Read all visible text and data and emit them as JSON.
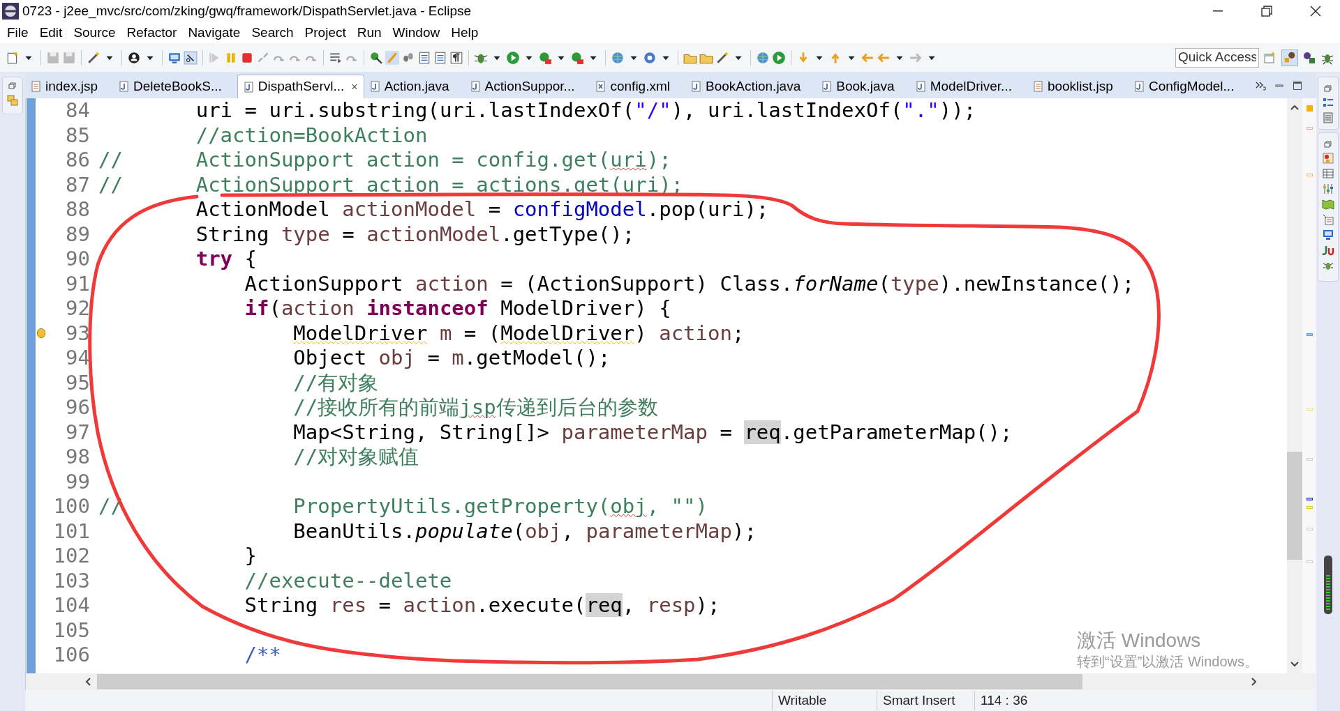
{
  "window": {
    "title": "0723 - j2ee_mvc/src/com/zking/gwq/framework/DispathServlet.java - Eclipse"
  },
  "menu": [
    "File",
    "Edit",
    "Source",
    "Refactor",
    "Navigate",
    "Search",
    "Project",
    "Run",
    "Window",
    "Help"
  ],
  "quick_access": {
    "placeholder": "Quick Access"
  },
  "tabs": [
    {
      "label": "index.jsp",
      "kind": "jsp",
      "selected": false
    },
    {
      "label": "DeleteBookS...",
      "kind": "java",
      "selected": false
    },
    {
      "label": "DispathServl...",
      "kind": "java",
      "selected": true,
      "close": "×"
    },
    {
      "label": "Action.java",
      "kind": "java",
      "selected": false
    },
    {
      "label": "ActionSuppor...",
      "kind": "java",
      "selected": false
    },
    {
      "label": "config.xml",
      "kind": "xml",
      "selected": false
    },
    {
      "label": "BookAction.java",
      "kind": "java",
      "selected": false
    },
    {
      "label": "Book.java",
      "kind": "java",
      "selected": false
    },
    {
      "label": "ModelDriver...",
      "kind": "java",
      "selected": false
    },
    {
      "label": "booklist.jsp",
      "kind": "jsp",
      "selected": false
    },
    {
      "label": "ConfigModel...",
      "kind": "java",
      "selected": false
    }
  ],
  "editor": {
    "lines": [
      {
        "number": "84",
        "segments": [
          {
            "text": "        uri = uri.substring(uri.lastIndexOf(",
            "kind": "plain"
          },
          {
            "text": "\"/\"",
            "kind": "string"
          },
          {
            "text": "), uri.lastIndexOf(",
            "kind": "plain"
          },
          {
            "text": "\".\"",
            "kind": "string"
          },
          {
            "text": "));",
            "kind": "plain"
          }
        ]
      },
      {
        "number": "85",
        "segments": [
          {
            "text": "        //action=BookAction",
            "kind": "comment"
          }
        ]
      },
      {
        "number": "86",
        "segments": [
          {
            "text": "//      ActionSupport action = config.get(",
            "kind": "comment"
          },
          {
            "text": "uri",
            "kind": "comment_misspelled"
          },
          {
            "text": ");",
            "kind": "comment"
          }
        ]
      },
      {
        "number": "87",
        "segments": [
          {
            "text": "//      ActionSupport action = actions.get(",
            "kind": "comment"
          },
          {
            "text": "uri",
            "kind": "comment_misspelled"
          },
          {
            "text": ");",
            "kind": "comment"
          }
        ]
      },
      {
        "number": "88",
        "segments": [
          {
            "text": "        ActionModel ",
            "kind": "plain"
          },
          {
            "text": "actionModel",
            "kind": "local"
          },
          {
            "text": " = ",
            "kind": "plain"
          },
          {
            "text": "configModel",
            "kind": "field"
          },
          {
            "text": ".pop(uri);",
            "kind": "plain"
          }
        ]
      },
      {
        "number": "89",
        "segments": [
          {
            "text": "        String ",
            "kind": "plain"
          },
          {
            "text": "type",
            "kind": "local"
          },
          {
            "text": " = ",
            "kind": "plain"
          },
          {
            "text": "actionModel",
            "kind": "local"
          },
          {
            "text": ".getType();",
            "kind": "plain"
          }
        ]
      },
      {
        "number": "90",
        "segments": [
          {
            "text": "        try",
            "kind": "keyword"
          },
          {
            "text": " {",
            "kind": "plain"
          }
        ]
      },
      {
        "number": "91",
        "segments": [
          {
            "text": "            ActionSupport ",
            "kind": "plain"
          },
          {
            "text": "action",
            "kind": "local"
          },
          {
            "text": " = (ActionSupport) Class.",
            "kind": "plain"
          },
          {
            "text": "forName",
            "kind": "static"
          },
          {
            "text": "(",
            "kind": "plain"
          },
          {
            "text": "type",
            "kind": "local"
          },
          {
            "text": ").newInstance();",
            "kind": "plain"
          }
        ]
      },
      {
        "number": "92",
        "segments": [
          {
            "text": "            if",
            "kind": "keyword"
          },
          {
            "text": "(",
            "kind": "plain"
          },
          {
            "text": "action",
            "kind": "local"
          },
          {
            "text": " instanceof",
            "kind": "keyword"
          },
          {
            "text": " ModelDriver) {",
            "kind": "plain"
          }
        ]
      },
      {
        "number": "93",
        "warning": true,
        "segments": [
          {
            "text": "                ModelDriver",
            "kind": "warning"
          },
          {
            "text": " m",
            "kind": "local"
          },
          {
            "text": " = (",
            "kind": "plain"
          },
          {
            "text": "ModelDriver",
            "kind": "warning"
          },
          {
            "text": ") ",
            "kind": "plain"
          },
          {
            "text": "action",
            "kind": "local"
          },
          {
            "text": ";",
            "kind": "plain"
          }
        ]
      },
      {
        "number": "94",
        "segments": [
          {
            "text": "                Object ",
            "kind": "plain"
          },
          {
            "text": "obj",
            "kind": "local"
          },
          {
            "text": " = ",
            "kind": "plain"
          },
          {
            "text": "m",
            "kind": "local"
          },
          {
            "text": ".getModel();",
            "kind": "plain"
          }
        ]
      },
      {
        "number": "95",
        "segments": [
          {
            "text": "                //有对象",
            "kind": "comment"
          }
        ]
      },
      {
        "number": "96",
        "segments": [
          {
            "text": "                //接收所有的前端",
            "kind": "comment"
          },
          {
            "text": "jsp",
            "kind": "comment_misspelled"
          },
          {
            "text": "传递到后台的参数",
            "kind": "comment"
          }
        ]
      },
      {
        "number": "97",
        "segments": [
          {
            "text": "                Map<String, String[]> ",
            "kind": "plain"
          },
          {
            "text": "parameterMap",
            "kind": "local"
          },
          {
            "text": " = ",
            "kind": "plain"
          },
          {
            "text": "req",
            "kind": "occurrence"
          },
          {
            "text": ".getParameterMap();",
            "kind": "plain"
          }
        ]
      },
      {
        "number": "98",
        "segments": [
          {
            "text": "                //对对象赋值",
            "kind": "comment"
          }
        ]
      },
      {
        "number": "99"
      },
      {
        "number": "100",
        "segments": [
          {
            "text": "//              PropertyUtils.getProperty(",
            "kind": "comment"
          },
          {
            "text": "obj",
            "kind": "comment_misspelled"
          },
          {
            "text": ", \"\")",
            "kind": "comment"
          }
        ]
      },
      {
        "number": "101",
        "segments": [
          {
            "text": "                BeanUtils.",
            "kind": "plain"
          },
          {
            "text": "populate",
            "kind": "static"
          },
          {
            "text": "(",
            "kind": "plain"
          },
          {
            "text": "obj",
            "kind": "local"
          },
          {
            "text": ", ",
            "kind": "plain"
          },
          {
            "text": "parameterMap",
            "kind": "local"
          },
          {
            "text": ");",
            "kind": "plain"
          }
        ]
      },
      {
        "number": "102",
        "segments": [
          {
            "text": "            }",
            "kind": "plain"
          }
        ]
      },
      {
        "number": "103",
        "segments": [
          {
            "text": "            //execute--delete",
            "kind": "comment"
          }
        ]
      },
      {
        "number": "104",
        "segments": [
          {
            "text": "            String ",
            "kind": "plain"
          },
          {
            "text": "res",
            "kind": "local"
          },
          {
            "text": " = ",
            "kind": "plain"
          },
          {
            "text": "action",
            "kind": "local"
          },
          {
            "text": ".execute(",
            "kind": "plain"
          },
          {
            "text": "req",
            "kind": "occurrence"
          },
          {
            "text": ", ",
            "kind": "plain"
          },
          {
            "text": "resp",
            "kind": "local"
          },
          {
            "text": ");",
            "kind": "plain"
          }
        ]
      },
      {
        "number": "105"
      },
      {
        "number": "106",
        "segments": [
          {
            "text": "            /**",
            "kind": "doc"
          }
        ]
      }
    ]
  },
  "activation": {
    "title": "激活 Windows",
    "subtitle": "转到“设置”以激活 Windows。"
  },
  "status_bar": [
    "Writable",
    "Smart Insert",
    "114 : 36"
  ]
}
